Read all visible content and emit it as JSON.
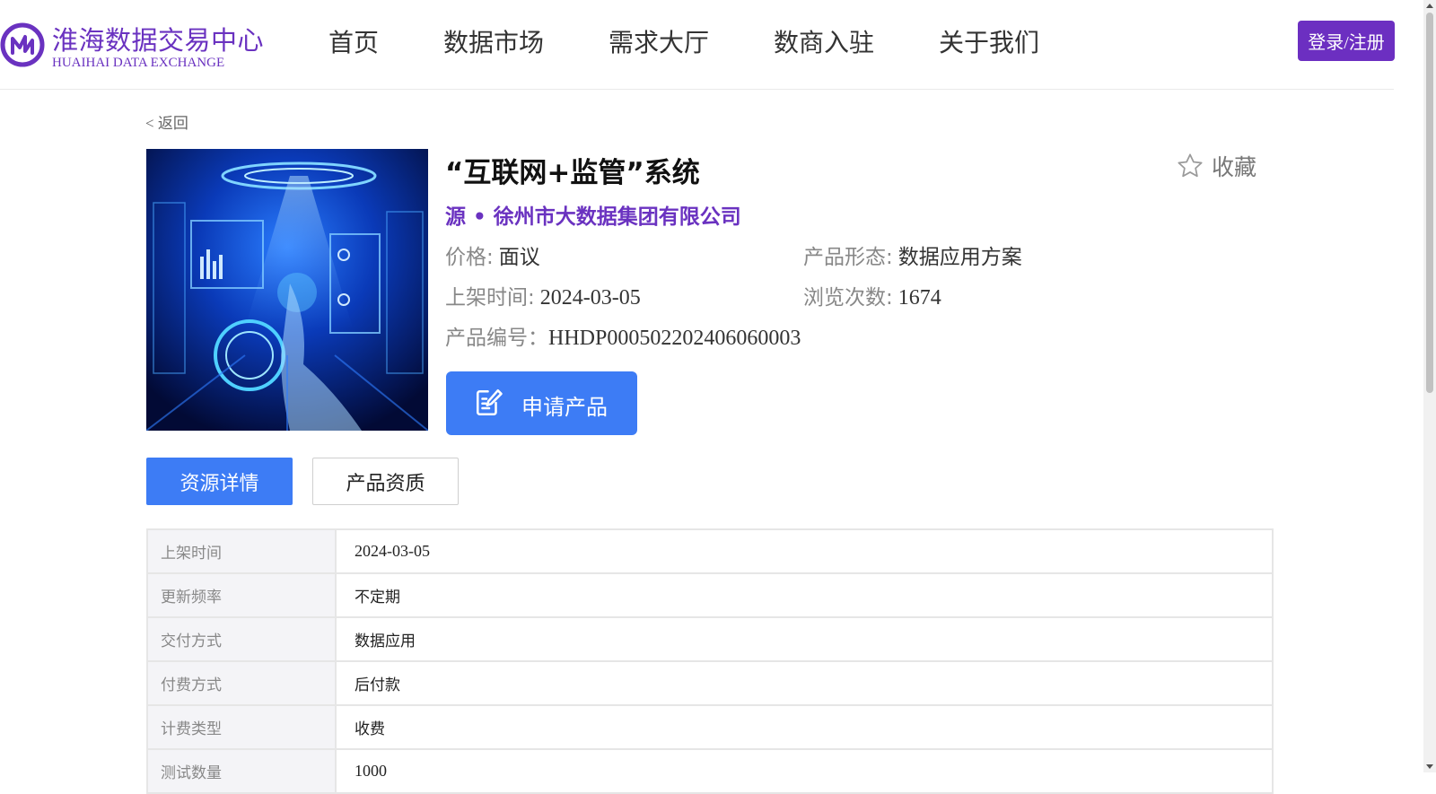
{
  "header": {
    "logo_cn": "淮海数据交易中心",
    "logo_en": "HUAIHAI DATA EXCHANGE",
    "nav": [
      "首页",
      "数据市场",
      "需求大厅",
      "数商入驻",
      "关于我们"
    ],
    "login_label": "登录/注册"
  },
  "page": {
    "back_label": "< 返回"
  },
  "product": {
    "title": "“互联网+监管”系统",
    "favorite_label": "收藏",
    "source": "源 • 徐州市大数据集团有限公司",
    "price_key": "价格:",
    "price_value": "面议",
    "form_key": "产品形态:",
    "form_value": "数据应用方案",
    "listed_key": "上架时间:",
    "listed_value": "2024-03-05",
    "views_key": "浏览次数:",
    "views_value": "1674",
    "code_key": "产品编号：",
    "code_value": "HHDP000502202406060003",
    "apply_label": "申请产品",
    "image_icon": "futuristic-digital-hand-image"
  },
  "tabs": [
    "资源详情",
    "产品资质"
  ],
  "details": [
    {
      "key": "上架时间",
      "value": "2024-03-05"
    },
    {
      "key": "更新频率",
      "value": "不定期"
    },
    {
      "key": "交付方式",
      "value": "数据应用"
    },
    {
      "key": "付费方式",
      "value": "后付款"
    },
    {
      "key": "计费类型",
      "value": "收费"
    },
    {
      "key": "测试数量",
      "value": "1000"
    }
  ],
  "colors": {
    "brand_purple": "#6a32c0",
    "accent_blue": "#3d7cf5"
  }
}
